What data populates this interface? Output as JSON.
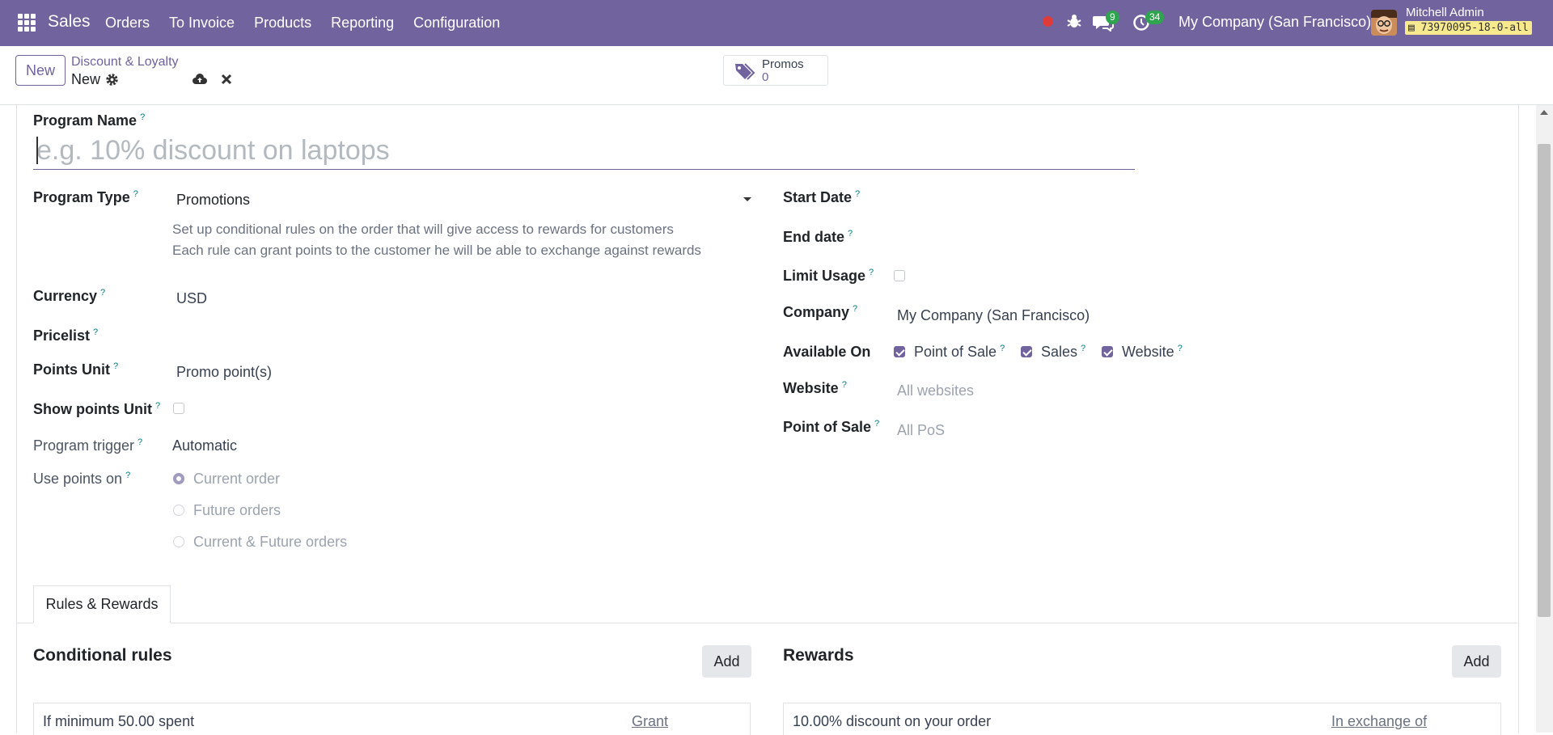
{
  "navbar": {
    "app_name": "Sales",
    "menu": [
      "Orders",
      "To Invoice",
      "Products",
      "Reporting",
      "Configuration"
    ],
    "messages_count": "9",
    "activities_count": "34",
    "company": "My Company (San Francisco)",
    "user_name": "Mitchell Admin",
    "db_name": "73970095-18-0-all"
  },
  "control": {
    "new_label": "New",
    "breadcrumb": "Discount & Loyalty",
    "record_name": "New",
    "promos_label": "Promos",
    "promos_count": "0"
  },
  "form": {
    "program_name_label": "Program Name",
    "program_name_placeholder": "e.g. 10% discount on laptops",
    "program_type_label": "Program Type",
    "program_type_value": "Promotions",
    "program_type_desc1": "Set up conditional rules on the order that will give access to rewards for customers",
    "program_type_desc2": "Each rule can grant points to the customer he will be able to exchange against rewards",
    "currency_label": "Currency",
    "currency_value": "USD",
    "pricelist_label": "Pricelist",
    "points_unit_label": "Points Unit",
    "points_unit_value": "Promo point(s)",
    "show_points_unit_label": "Show points Unit",
    "program_trigger_label": "Program trigger",
    "program_trigger_value": "Automatic",
    "use_points_on_label": "Use points on",
    "use_points_options": [
      "Current order",
      "Future orders",
      "Current & Future orders"
    ],
    "start_date_label": "Start Date",
    "end_date_label": "End date",
    "limit_usage_label": "Limit Usage",
    "company_label": "Company",
    "company_value": "My Company (San Francisco)",
    "available_on_label": "Available On",
    "available_on_options": [
      "Point of Sale",
      "Sales",
      "Website"
    ],
    "website_label": "Website",
    "website_placeholder": "All websites",
    "pos_label": "Point of Sale",
    "pos_placeholder": "All PoS",
    "help_mark": "?"
  },
  "tabs": {
    "rules_rewards": "Rules & Rewards"
  },
  "rules": {
    "title": "Conditional rules",
    "add_label": "Add",
    "first_rule": "If minimum 50.00 spent",
    "first_rule_link": "Grant"
  },
  "rewards": {
    "title": "Rewards",
    "add_label": "Add",
    "first_reward": "10.00% discount on your order",
    "first_reward_link": "In exchange of"
  },
  "colors": {
    "brand": "#71639e",
    "badge": "#2ea44f",
    "help": "#017e84"
  }
}
